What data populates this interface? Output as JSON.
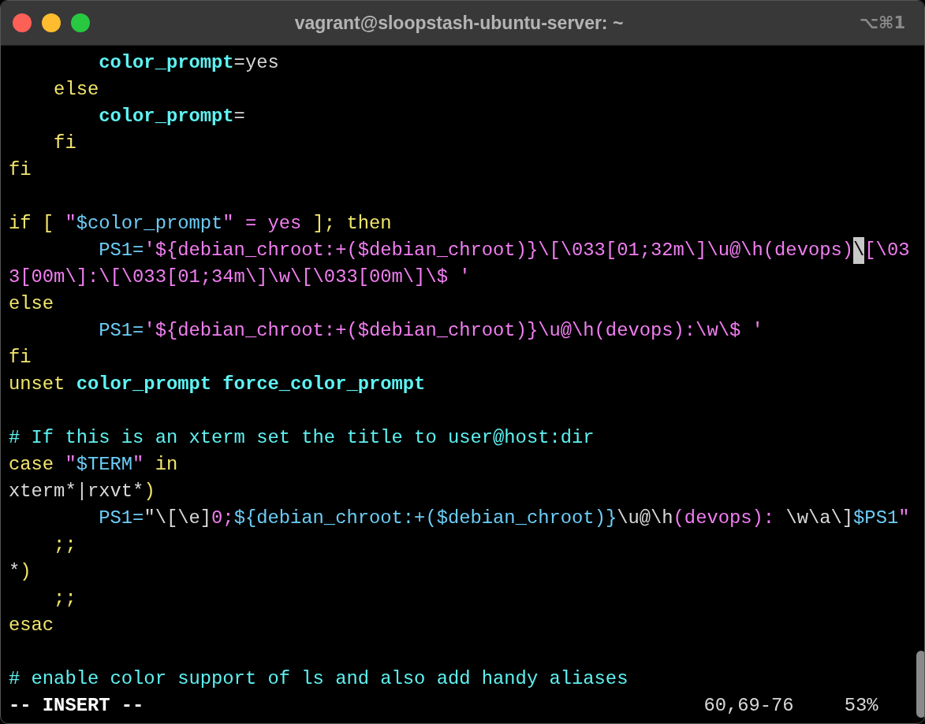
{
  "window": {
    "title": "vagrant@sloopstash-ubuntu-server: ~",
    "shortcut": "⌥⌘1"
  },
  "lines": [
    {
      "kind": "code",
      "segments": [
        {
          "text": "        color_prompt",
          "color": "#5ef2f2",
          "bold": true
        },
        {
          "text": "=yes",
          "color": "#d8d8d8",
          "bold": false
        }
      ]
    },
    {
      "kind": "code",
      "segments": [
        {
          "text": "    else",
          "color": "#f2e66b",
          "bold": false
        }
      ]
    },
    {
      "kind": "code",
      "segments": [
        {
          "text": "        color_prompt",
          "color": "#5ef2f2",
          "bold": true
        },
        {
          "text": "=",
          "color": "#d8d8d8",
          "bold": false
        }
      ]
    },
    {
      "kind": "code",
      "segments": [
        {
          "text": "    fi",
          "color": "#f2e66b",
          "bold": false
        }
      ]
    },
    {
      "kind": "code",
      "segments": [
        {
          "text": "fi",
          "color": "#f2e66b",
          "bold": false
        }
      ]
    },
    {
      "kind": "blank"
    },
    {
      "kind": "code",
      "segments": [
        {
          "text": "if [ ",
          "color": "#f2e66b",
          "bold": false
        },
        {
          "text": "\"",
          "color": "#f27ef2",
          "bold": false
        },
        {
          "text": "$color_prompt",
          "color": "#6ccdf7",
          "bold": false
        },
        {
          "text": "\" = yes",
          "color": "#f27ef2",
          "bold": false
        },
        {
          "text": " ]; then",
          "color": "#f2e66b",
          "bold": false
        }
      ]
    },
    {
      "kind": "code",
      "segments": [
        {
          "text": "        PS1=",
          "color": "#6ccdf7",
          "bold": false
        },
        {
          "text": "'${debian_chroot:+($debian_chroot)}\\[\\033[01;32m\\]\\u@\\h(devops)",
          "color": "#f27ef2",
          "bold": false
        },
        {
          "text": "\\",
          "bold": false,
          "cursor": true
        },
        {
          "text": "[\\03",
          "color": "#f27ef2",
          "bold": false
        }
      ]
    },
    {
      "kind": "code",
      "segments": [
        {
          "text": "3[00m\\]:\\[\\033[01;34m\\]\\w\\[\\033[00m\\]\\$ '",
          "color": "#f27ef2",
          "bold": false
        }
      ]
    },
    {
      "kind": "code",
      "segments": [
        {
          "text": "else",
          "color": "#f2e66b",
          "bold": false
        }
      ]
    },
    {
      "kind": "code",
      "segments": [
        {
          "text": "        PS1=",
          "color": "#6ccdf7",
          "bold": false
        },
        {
          "text": "'${debian_chroot:+($debian_chroot)}\\u@\\h(devops):\\w\\$ '",
          "color": "#f27ef2",
          "bold": false
        }
      ]
    },
    {
      "kind": "code",
      "segments": [
        {
          "text": "fi",
          "color": "#f2e66b",
          "bold": false
        }
      ]
    },
    {
      "kind": "code",
      "segments": [
        {
          "text": "unset",
          "color": "#f2e66b",
          "bold": false
        },
        {
          "text": " color_prompt force_color_prompt",
          "color": "#5ef2f2",
          "bold": true
        }
      ]
    },
    {
      "kind": "blank"
    },
    {
      "kind": "code",
      "segments": [
        {
          "text": "# If this is an xterm set the title to user@host:dir",
          "color": "#5ef2f2",
          "bold": false
        }
      ]
    },
    {
      "kind": "code",
      "segments": [
        {
          "text": "case ",
          "color": "#f2e66b",
          "bold": false
        },
        {
          "text": "\"",
          "color": "#f27ef2",
          "bold": false
        },
        {
          "text": "$TERM",
          "color": "#6ccdf7",
          "bold": false
        },
        {
          "text": "\"",
          "color": "#f27ef2",
          "bold": false
        },
        {
          "text": " in",
          "color": "#f2e66b",
          "bold": false
        }
      ]
    },
    {
      "kind": "code",
      "segments": [
        {
          "text": "xterm*|rxvt*",
          "color": "#d8d8d8",
          "bold": false
        },
        {
          "text": ")",
          "color": "#f2e66b",
          "bold": false
        }
      ]
    },
    {
      "kind": "code",
      "segments": [
        {
          "text": "        PS1=",
          "color": "#6ccdf7",
          "bold": false
        },
        {
          "text": "\"\\[\\e]",
          "color": "#d8d8d8",
          "bold": false
        },
        {
          "text": "0;",
          "color": "#f27ef2",
          "bold": false
        },
        {
          "text": "${debian_chroot:+(",
          "color": "#6ccdf7",
          "bold": false
        },
        {
          "text": "$debian_chroot",
          "color": "#6ccdf7",
          "bold": false
        },
        {
          "text": ")}",
          "color": "#6ccdf7",
          "bold": false
        },
        {
          "text": "\\u@\\h",
          "color": "#d8d8d8",
          "bold": false
        },
        {
          "text": "(devops): ",
          "color": "#f27ef2",
          "bold": false
        },
        {
          "text": "\\w\\a\\]",
          "color": "#d8d8d8",
          "bold": false
        },
        {
          "text": "$PS1",
          "color": "#6ccdf7",
          "bold": false
        },
        {
          "text": "\"",
          "color": "#f27ef2",
          "bold": false
        }
      ]
    },
    {
      "kind": "code",
      "segments": [
        {
          "text": "    ;;",
          "color": "#f2e66b",
          "bold": false
        }
      ]
    },
    {
      "kind": "code",
      "segments": [
        {
          "text": "*",
          "color": "#d8d8d8",
          "bold": false
        },
        {
          "text": ")",
          "color": "#f2e66b",
          "bold": false
        }
      ]
    },
    {
      "kind": "code",
      "segments": [
        {
          "text": "    ;;",
          "color": "#f2e66b",
          "bold": false
        }
      ]
    },
    {
      "kind": "code",
      "segments": [
        {
          "text": "esac",
          "color": "#f2e66b",
          "bold": false
        }
      ]
    },
    {
      "kind": "blank"
    },
    {
      "kind": "code",
      "segments": [
        {
          "text": "# enable color support of ls and also add handy aliases",
          "color": "#5ef2f2",
          "bold": false
        }
      ]
    }
  ],
  "status_bar": {
    "mode": "-- INSERT --",
    "position": "60,69-76",
    "percent": "53%"
  }
}
